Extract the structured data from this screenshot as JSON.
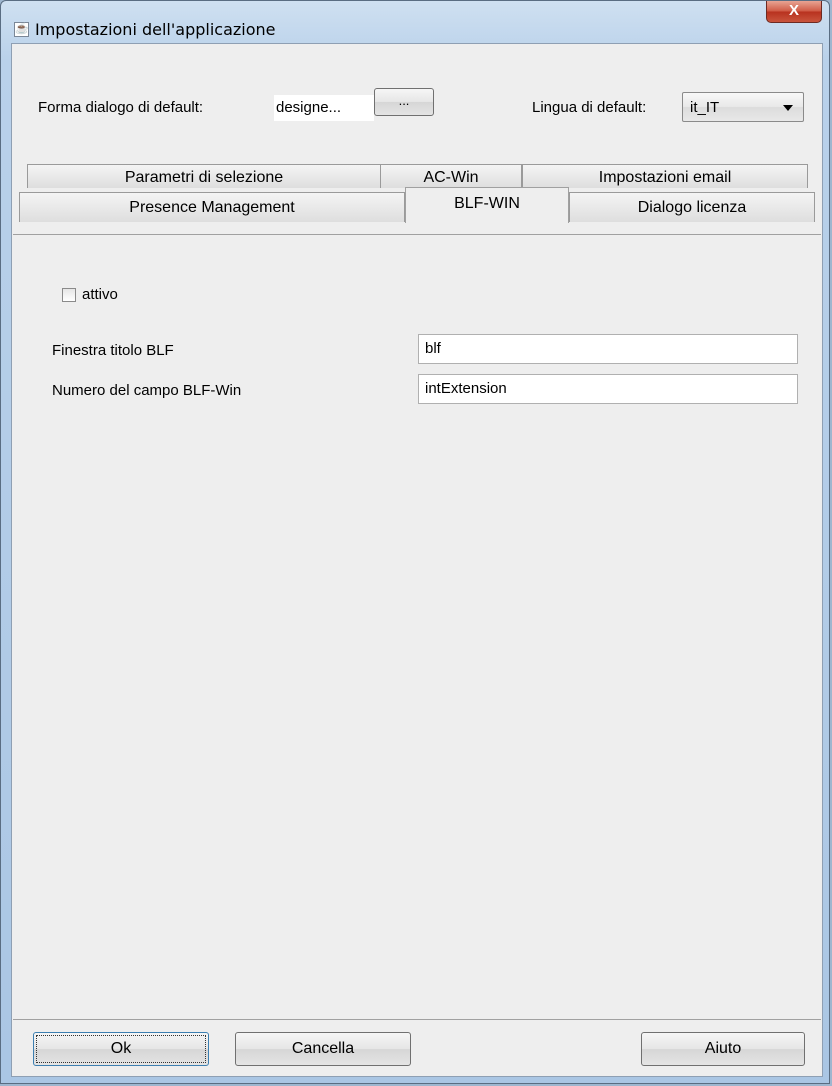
{
  "window": {
    "title": "Impostazioni dell'applicazione",
    "close_label": "X"
  },
  "top": {
    "dialog_label": "Forma dialogo di default:",
    "dialog_value": "designe...",
    "browse_label": "...",
    "language_label": "Lingua di default:",
    "language_value": "it_IT"
  },
  "tabs": {
    "row1": [
      "Parametri di selezione",
      "AC-Win",
      "Impostazioni email"
    ],
    "row2": [
      "Presence Management",
      "BLF-WIN",
      "Dialogo licenza"
    ],
    "active": "BLF-WIN"
  },
  "blf": {
    "active_label": "attivo",
    "active_checked": false,
    "window_title_label": "Finestra titolo BLF",
    "window_title_value": "blf",
    "field_number_label": "Numero del campo BLF-Win",
    "field_number_value": "intExtension"
  },
  "footer": {
    "ok": "Ok",
    "cancel": "Cancella",
    "help": "Aiuto"
  },
  "colors": {
    "titlebar": "#b9d1ea",
    "close": "#c9543d",
    "panel": "#eeeeee"
  }
}
